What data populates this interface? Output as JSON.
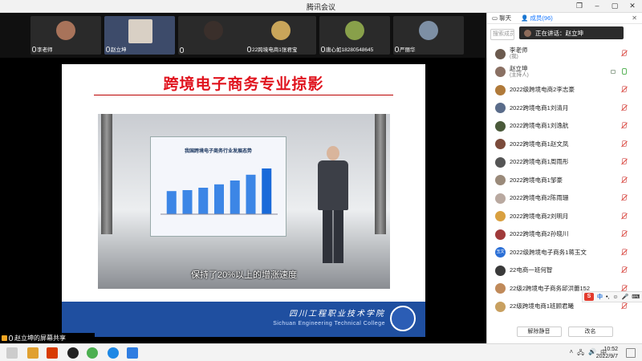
{
  "window": {
    "title": "腾讯会议"
  },
  "participants_strip": [
    {
      "name": "李老师",
      "color": "#a8735a"
    },
    {
      "name": "赵立坤",
      "color": "#3d5b8c"
    },
    {
      "name": "",
      "color": "#3a2f2b"
    },
    {
      "name": "22跨境电商1张君宝",
      "color": "#c9a55a"
    },
    {
      "name": "唐心如18280548645",
      "color": "#88a04a"
    },
    {
      "name": "严丽华",
      "color": "#7d8fa4"
    }
  ],
  "slide": {
    "title": "跨境电子商务专业掠影",
    "screen_title": "我国跨境电子商务行业发展态势",
    "subtitle": "保持了20%以上的增涨速度",
    "footer_cn": "四川工程职业技术学院",
    "footer_en": "Sichuan Engineering Technical College",
    "chart_bars": [
      0.48,
      0.5,
      0.55,
      0.62,
      0.7,
      0.82,
      0.95
    ]
  },
  "share_bar": {
    "label": "赵立坤的屏幕共享"
  },
  "panel": {
    "tab_chat": "聊天",
    "tab_members": "成员(96)",
    "search_placeholder": "搜索成员",
    "speaking": "正在讲话：赵立坤",
    "unmute_all": "解除静音",
    "rename": "改名",
    "ime_label": "中"
  },
  "members": [
    {
      "name": "李老师",
      "sub": "(我)",
      "color": "#6b5a4e",
      "mic": "off"
    },
    {
      "name": "赵立坤",
      "sub": "(主持人)",
      "color": "#8a7063",
      "mic": "on"
    },
    {
      "name": "2022级跨境电商2李志豪",
      "sub": "",
      "color": "#b07a3a",
      "mic": "off"
    },
    {
      "name": "2022跨境电商1刘清月",
      "sub": "",
      "color": "#5a6c8a",
      "mic": "off"
    },
    {
      "name": "2022跨境电商1刘逸航",
      "sub": "",
      "color": "#4a5a3a",
      "mic": "off"
    },
    {
      "name": "2022跨境电商1赵文凤",
      "sub": "",
      "color": "#7b4b3b",
      "mic": "off"
    },
    {
      "name": "2022跨境电商1周雨彤",
      "sub": "",
      "color": "#555555",
      "mic": "off"
    },
    {
      "name": "2022跨境电商1邹豪",
      "sub": "",
      "color": "#9a8a7a",
      "mic": "off"
    },
    {
      "name": "2022跨境电商2陈雨珊",
      "sub": "",
      "color": "#b9a9a0",
      "mic": "off"
    },
    {
      "name": "2022跨境电商2刘明月",
      "sub": "",
      "color": "#d9a040",
      "mic": "off"
    },
    {
      "name": "2022跨境电商2孙晓川",
      "sub": "",
      "color": "#a03a3a",
      "mic": "off"
    },
    {
      "name": "2022级跨境电子商务1蒋玉文",
      "sub": "",
      "color": "#2b6fd6",
      "initials": "玉文",
      "mic": "off"
    },
    {
      "name": "22电商一班何智",
      "sub": "",
      "color": "#3a3a3a",
      "mic": "off"
    },
    {
      "name": "22级2跨境电子商务邱洪蕾152",
      "sub": "",
      "color": "#c08a5a",
      "mic": "off"
    },
    {
      "name": "22级跨境电商1班顾君曦",
      "sub": "",
      "color": "#c8a060",
      "mic": "off"
    }
  ],
  "taskbar": {
    "time": "10:52",
    "date": "2022/9/7",
    "tray_lang": "中"
  }
}
